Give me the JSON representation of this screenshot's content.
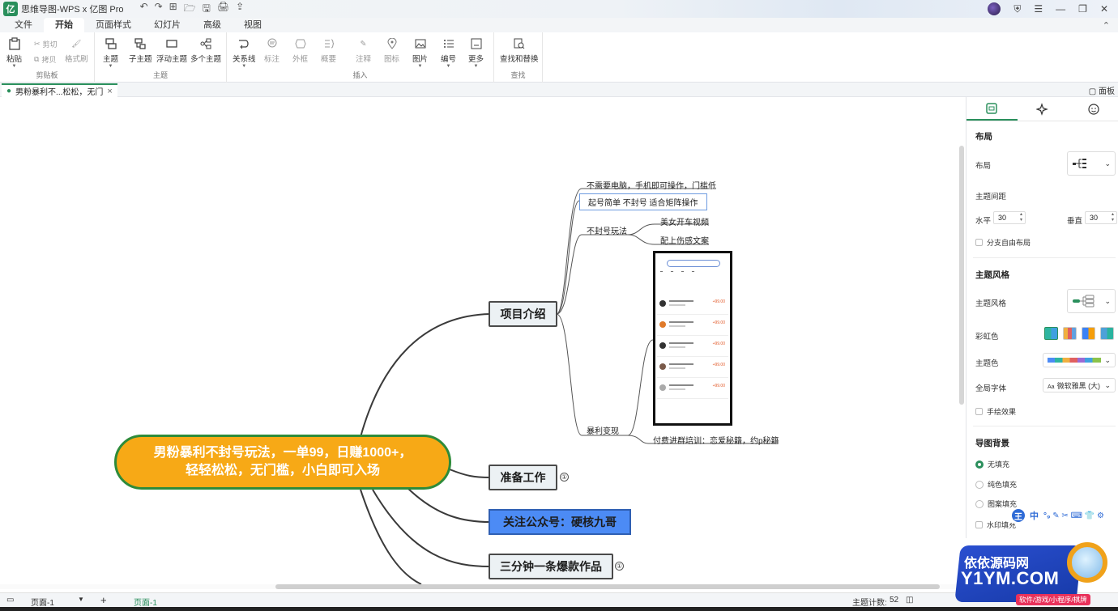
{
  "app": {
    "logo_text": "亿",
    "title": "思维导图-WPS x 亿图 Pro"
  },
  "quick_access": [
    "↶",
    "↷",
    "⊞",
    "🗁",
    "🖫",
    "🖨",
    "⇪"
  ],
  "window_controls": [
    "☰",
    "—",
    "❐",
    "✕"
  ],
  "menu": {
    "tabs": [
      "文件",
      "开始",
      "页面样式",
      "幻灯片",
      "高级",
      "视图"
    ],
    "active": "开始"
  },
  "ribbon": {
    "clipboard": {
      "label": "剪贴板",
      "paste": "粘贴",
      "cut": "剪切",
      "copy": "拷贝",
      "format_painter": "格式刷"
    },
    "theme": {
      "label": "主题",
      "main_topic": "主题",
      "sub_topic": "子主题",
      "floating_topic": "浮动主题",
      "multi_topic": "多个主题"
    },
    "insert": {
      "label": "插入",
      "relation": "关系线",
      "callout": "标注",
      "boundary": "外框",
      "summary": "概要",
      "note": "注释",
      "icon": "图标",
      "image": "图片",
      "numbering": "编号",
      "more": "更多"
    },
    "find": {
      "label": "查找",
      "find_replace": "查找和替换"
    }
  },
  "doc_tab": {
    "title": "男粉暴利不...松松，无门",
    "close": "×"
  },
  "doc_tabs_right": "▢ 面板",
  "mindmap": {
    "root": {
      "line1": "男粉暴利不封号玩法，一单99，日赚1000+，",
      "line2": "轻轻松松，无门槛，小白即可入场"
    },
    "topics": [
      {
        "label": "项目介绍",
        "badge": ""
      },
      {
        "label": "准备工作",
        "badge": "①"
      },
      {
        "label": "关注公众号：硬核九哥",
        "badge": ""
      },
      {
        "label": "三分钟一条爆款作品",
        "badge": "①"
      }
    ],
    "leaves": {
      "l1": "不需要电脑，手机即可操作，门槛低",
      "l2": "起号简单 不封号 适合矩阵操作",
      "l3": "不封号玩法",
      "l3a": "美女开车视频",
      "l3b": "配上伤感文案",
      "l4": "暴利变现",
      "l4a": "付费进群培训：恋爱秘籍，约p秘籍"
    },
    "phone_prices": [
      "+99.00",
      "+99.00",
      "+99.00",
      "+99.00",
      "+99.00"
    ]
  },
  "panel": {
    "layout_header": "布局",
    "layout_label": "布局",
    "spacing_label": "主题间距",
    "horizontal_label": "水平",
    "horizontal_value": "30",
    "vertical_label": "垂直",
    "vertical_value": "30",
    "free_layout": "分支自由布局",
    "style_header": "主题风格",
    "style_label": "主题风格",
    "rainbow_label": "彩虹色",
    "color_label": "主题色",
    "font_label": "全局字体",
    "font_value": "微软雅黑 (大)",
    "font_prefix": "Aa",
    "hand_drawn": "手绘效果",
    "bg_header": "导图背景",
    "bg_none": "无填充",
    "bg_solid": "纯色填充",
    "bg_pattern": "图案填充",
    "bg_watermark": "水印填充",
    "accent_color": "#2a8f5c"
  },
  "ime": {
    "key": "王",
    "mode": "中",
    "symbols": "°₉ ✎ ✂ ⌨ 👕 ⚙"
  },
  "status": {
    "page_select": "页面-1",
    "add": "+",
    "page_tab": "页面-1",
    "topic_count_label": "主题计数:",
    "topic_count": "52"
  },
  "watermark": {
    "line1": "依依源码网",
    "line2": "Y1YM.COM",
    "line3": "软件/游戏/小程序/棋牌"
  }
}
